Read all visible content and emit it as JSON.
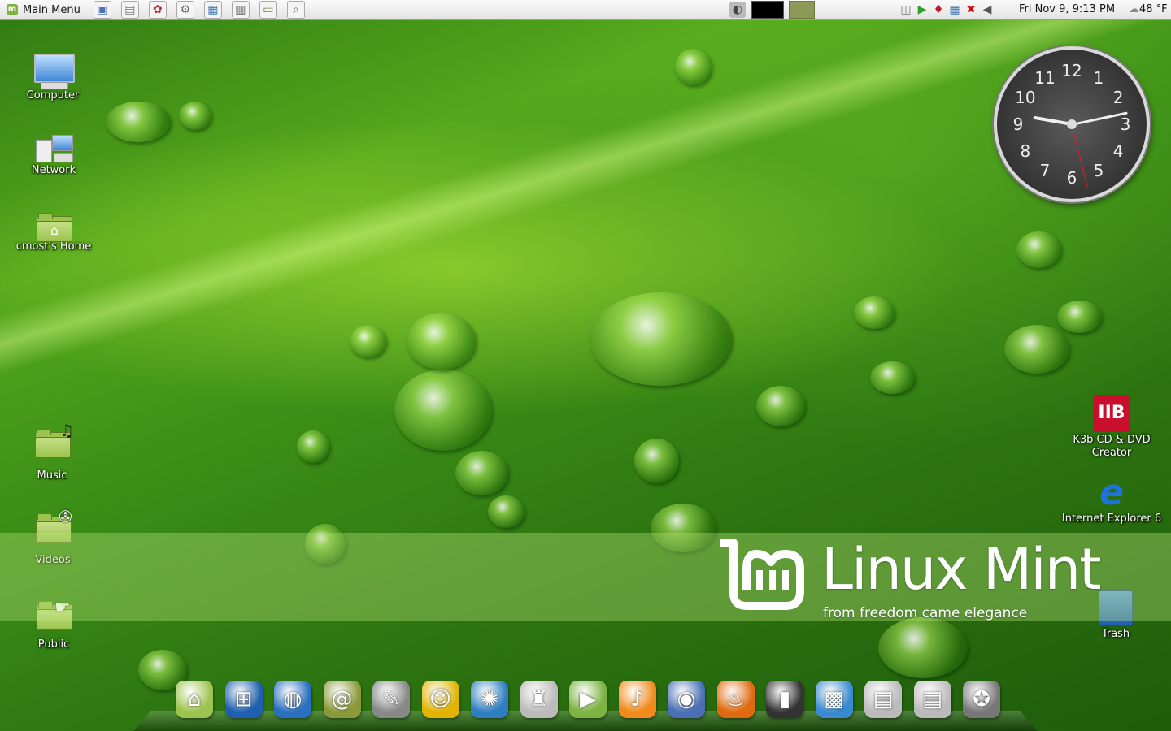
{
  "panel": {
    "menu_label": "Main Menu",
    "launchers": [
      {
        "icon": "screenshot-tool-icon",
        "color": "#4a6fb5",
        "glyph": "▣"
      },
      {
        "icon": "document-viewer-icon",
        "color": "#777",
        "glyph": "▤"
      },
      {
        "icon": "package-manager-icon",
        "color": "#a33",
        "glyph": "✿"
      },
      {
        "icon": "settings-gears-icon",
        "color": "#666",
        "glyph": "⚙"
      },
      {
        "icon": "system-monitor-icon",
        "color": "#3a6fb0",
        "glyph": "▦"
      },
      {
        "icon": "calculator-icon",
        "color": "#555",
        "glyph": "▥"
      },
      {
        "icon": "file-manager-icon",
        "color": "#6b8e23",
        "glyph": "▭"
      },
      {
        "icon": "folder-search-icon",
        "color": "#555",
        "glyph": "⌕"
      }
    ],
    "datetime": "Fri Nov  9,  9:13 PM",
    "temperature": "48 °F"
  },
  "desktop_icons": {
    "computer": "Computer",
    "network": "Network",
    "home": "cmost's Home",
    "music": "Music",
    "videos": "Videos",
    "public": "Public",
    "k3b": "K3b CD & DVD Creator",
    "ie6": "Internet Explorer 6",
    "trash": "Trash"
  },
  "clock": {
    "numbers": [
      "12",
      "1",
      "2",
      "3",
      "4",
      "5",
      "6",
      "7",
      "8",
      "9",
      "10",
      "11"
    ],
    "time": "9:13"
  },
  "branding": {
    "title": "Linux Mint",
    "tagline": "from freedom came elegance"
  },
  "dock": [
    {
      "icon": "home-folder-icon",
      "color": "#9cc34e",
      "glyph": "⌂"
    },
    {
      "icon": "windows-start-icon",
      "color": "#1f5fb0",
      "glyph": "⊞"
    },
    {
      "icon": "web-browser-icon",
      "color": "#2a6fc0",
      "glyph": "◍"
    },
    {
      "icon": "address-book-icon",
      "color": "#8a9a3a",
      "glyph": "@"
    },
    {
      "icon": "text-editor-icon",
      "color": "#888",
      "glyph": "✎"
    },
    {
      "icon": "messenger-icon",
      "color": "#e0b400",
      "glyph": "☺"
    },
    {
      "icon": "music-player-icon",
      "color": "#2f7fc0",
      "glyph": "✺"
    },
    {
      "icon": "joystick-icon",
      "color": "#bbb",
      "glyph": "♜"
    },
    {
      "icon": "media-play-icon",
      "color": "#7cb342",
      "glyph": "▶"
    },
    {
      "icon": "audio-cd-icon",
      "color": "#f08a1c",
      "glyph": "♪"
    },
    {
      "icon": "sound-system-icon",
      "color": "#4a6fb5",
      "glyph": "◉"
    },
    {
      "icon": "burner-flame-icon",
      "color": "#e06a10",
      "glyph": "♨"
    },
    {
      "icon": "terminal-icon",
      "color": "#333",
      "glyph": "▮"
    },
    {
      "icon": "image-viewer-icon",
      "color": "#3a8ad0",
      "glyph": "▩"
    },
    {
      "icon": "cabinet-icon",
      "color": "#bbb",
      "glyph": "▤"
    },
    {
      "icon": "cabinet-icon",
      "color": "#bbb",
      "glyph": "▤"
    },
    {
      "icon": "gimp-icon",
      "color": "#777",
      "glyph": "✪"
    }
  ]
}
